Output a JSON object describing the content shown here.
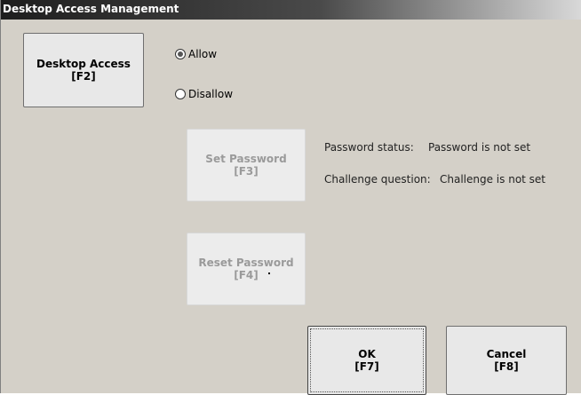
{
  "window": {
    "title": "Desktop Access Management"
  },
  "desktop_access_button": {
    "line1": "Desktop Access",
    "line2": "[F2]"
  },
  "radio_options": [
    {
      "label": "Allow",
      "checked": true
    },
    {
      "label": "Disallow",
      "checked": false
    }
  ],
  "set_password_button": {
    "line1": "Set Password",
    "line2": "[F3]"
  },
  "reset_password_button": {
    "line1": "Reset Password",
    "line2": "[F4]"
  },
  "status": {
    "password_label": "Password status:",
    "password_value": "Password is not set",
    "challenge_label": "Challenge question:",
    "challenge_value": "Challenge is not set"
  },
  "ok_button": {
    "line1": "OK",
    "line2": "[F7]"
  },
  "cancel_button": {
    "line1": "Cancel",
    "line2": "[F8]"
  },
  "colors": {
    "window_bg": "#d4d0c8",
    "disabled_text": "#9a9a9a"
  }
}
